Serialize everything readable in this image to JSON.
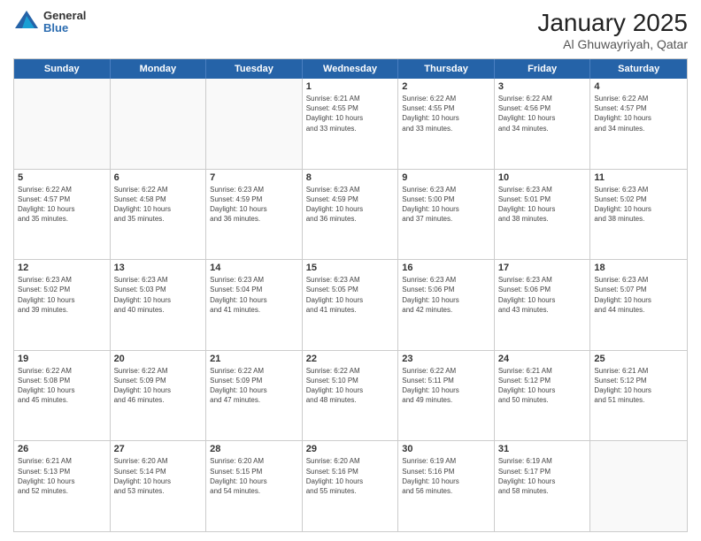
{
  "logo": {
    "general": "General",
    "blue": "Blue"
  },
  "title": {
    "month": "January 2025",
    "location": "Al Ghuwayriyah, Qatar"
  },
  "header_days": [
    "Sunday",
    "Monday",
    "Tuesday",
    "Wednesday",
    "Thursday",
    "Friday",
    "Saturday"
  ],
  "weeks": [
    [
      {
        "day": "",
        "info": "",
        "empty": true
      },
      {
        "day": "",
        "info": "",
        "empty": true
      },
      {
        "day": "",
        "info": "",
        "empty": true
      },
      {
        "day": "1",
        "info": "Sunrise: 6:21 AM\nSunset: 4:55 PM\nDaylight: 10 hours\nand 33 minutes."
      },
      {
        "day": "2",
        "info": "Sunrise: 6:22 AM\nSunset: 4:55 PM\nDaylight: 10 hours\nand 33 minutes."
      },
      {
        "day": "3",
        "info": "Sunrise: 6:22 AM\nSunset: 4:56 PM\nDaylight: 10 hours\nand 34 minutes."
      },
      {
        "day": "4",
        "info": "Sunrise: 6:22 AM\nSunset: 4:57 PM\nDaylight: 10 hours\nand 34 minutes."
      }
    ],
    [
      {
        "day": "5",
        "info": "Sunrise: 6:22 AM\nSunset: 4:57 PM\nDaylight: 10 hours\nand 35 minutes."
      },
      {
        "day": "6",
        "info": "Sunrise: 6:22 AM\nSunset: 4:58 PM\nDaylight: 10 hours\nand 35 minutes."
      },
      {
        "day": "7",
        "info": "Sunrise: 6:23 AM\nSunset: 4:59 PM\nDaylight: 10 hours\nand 36 minutes."
      },
      {
        "day": "8",
        "info": "Sunrise: 6:23 AM\nSunset: 4:59 PM\nDaylight: 10 hours\nand 36 minutes."
      },
      {
        "day": "9",
        "info": "Sunrise: 6:23 AM\nSunset: 5:00 PM\nDaylight: 10 hours\nand 37 minutes."
      },
      {
        "day": "10",
        "info": "Sunrise: 6:23 AM\nSunset: 5:01 PM\nDaylight: 10 hours\nand 38 minutes."
      },
      {
        "day": "11",
        "info": "Sunrise: 6:23 AM\nSunset: 5:02 PM\nDaylight: 10 hours\nand 38 minutes."
      }
    ],
    [
      {
        "day": "12",
        "info": "Sunrise: 6:23 AM\nSunset: 5:02 PM\nDaylight: 10 hours\nand 39 minutes."
      },
      {
        "day": "13",
        "info": "Sunrise: 6:23 AM\nSunset: 5:03 PM\nDaylight: 10 hours\nand 40 minutes."
      },
      {
        "day": "14",
        "info": "Sunrise: 6:23 AM\nSunset: 5:04 PM\nDaylight: 10 hours\nand 41 minutes."
      },
      {
        "day": "15",
        "info": "Sunrise: 6:23 AM\nSunset: 5:05 PM\nDaylight: 10 hours\nand 41 minutes."
      },
      {
        "day": "16",
        "info": "Sunrise: 6:23 AM\nSunset: 5:06 PM\nDaylight: 10 hours\nand 42 minutes."
      },
      {
        "day": "17",
        "info": "Sunrise: 6:23 AM\nSunset: 5:06 PM\nDaylight: 10 hours\nand 43 minutes."
      },
      {
        "day": "18",
        "info": "Sunrise: 6:23 AM\nSunset: 5:07 PM\nDaylight: 10 hours\nand 44 minutes."
      }
    ],
    [
      {
        "day": "19",
        "info": "Sunrise: 6:22 AM\nSunset: 5:08 PM\nDaylight: 10 hours\nand 45 minutes."
      },
      {
        "day": "20",
        "info": "Sunrise: 6:22 AM\nSunset: 5:09 PM\nDaylight: 10 hours\nand 46 minutes."
      },
      {
        "day": "21",
        "info": "Sunrise: 6:22 AM\nSunset: 5:09 PM\nDaylight: 10 hours\nand 47 minutes."
      },
      {
        "day": "22",
        "info": "Sunrise: 6:22 AM\nSunset: 5:10 PM\nDaylight: 10 hours\nand 48 minutes."
      },
      {
        "day": "23",
        "info": "Sunrise: 6:22 AM\nSunset: 5:11 PM\nDaylight: 10 hours\nand 49 minutes."
      },
      {
        "day": "24",
        "info": "Sunrise: 6:21 AM\nSunset: 5:12 PM\nDaylight: 10 hours\nand 50 minutes."
      },
      {
        "day": "25",
        "info": "Sunrise: 6:21 AM\nSunset: 5:12 PM\nDaylight: 10 hours\nand 51 minutes."
      }
    ],
    [
      {
        "day": "26",
        "info": "Sunrise: 6:21 AM\nSunset: 5:13 PM\nDaylight: 10 hours\nand 52 minutes."
      },
      {
        "day": "27",
        "info": "Sunrise: 6:20 AM\nSunset: 5:14 PM\nDaylight: 10 hours\nand 53 minutes."
      },
      {
        "day": "28",
        "info": "Sunrise: 6:20 AM\nSunset: 5:15 PM\nDaylight: 10 hours\nand 54 minutes."
      },
      {
        "day": "29",
        "info": "Sunrise: 6:20 AM\nSunset: 5:16 PM\nDaylight: 10 hours\nand 55 minutes."
      },
      {
        "day": "30",
        "info": "Sunrise: 6:19 AM\nSunset: 5:16 PM\nDaylight: 10 hours\nand 56 minutes."
      },
      {
        "day": "31",
        "info": "Sunrise: 6:19 AM\nSunset: 5:17 PM\nDaylight: 10 hours\nand 58 minutes."
      },
      {
        "day": "",
        "info": "",
        "empty": true
      }
    ]
  ]
}
